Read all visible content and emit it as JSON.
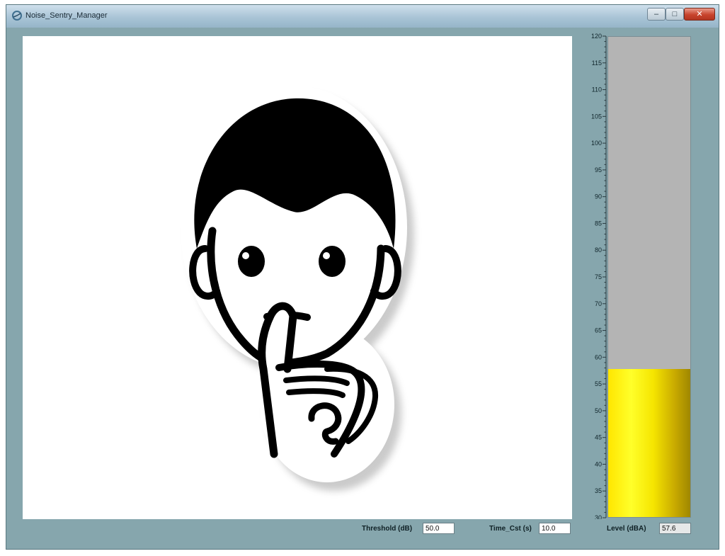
{
  "window": {
    "title": "Noise_Sentry_Manager",
    "minimize_glyph": "–",
    "maximize_glyph": "□",
    "close_glyph": "✕"
  },
  "icons": [
    "app-icon",
    "hush-face-icon"
  ],
  "controls": {
    "threshold_label": "Threshold (dB)",
    "threshold_value": "50.0",
    "time_label": "Time_Cst (s)",
    "time_value": "10.0",
    "level_label": "Level (dBA)",
    "level_value": "57.6"
  },
  "meter": {
    "min": 30,
    "max": 120,
    "major_step": 5,
    "level": 57.6
  },
  "colors": {
    "window_frame": "#86a6ad",
    "gauge_empty": "#b4b4b4",
    "gauge_fill": "#ffff2a"
  }
}
